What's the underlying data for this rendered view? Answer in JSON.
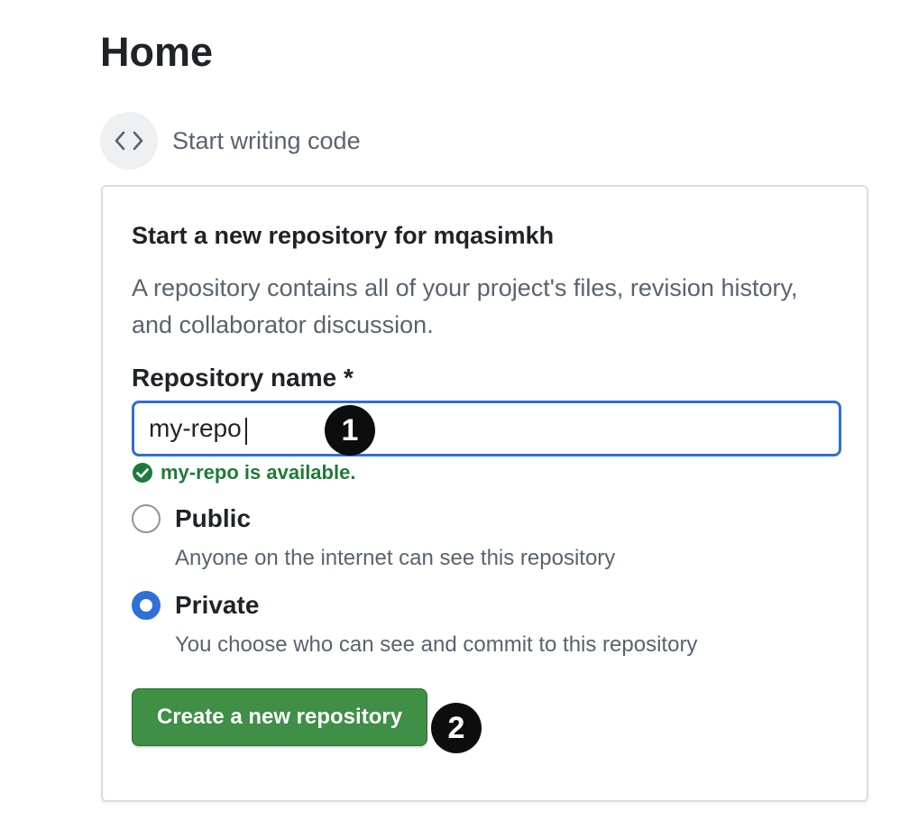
{
  "page": {
    "title": "Home"
  },
  "section": {
    "icon": "code-icon",
    "label": "Start writing code"
  },
  "new_repo_card": {
    "title": "Start a new repository for mqasimkh",
    "description": "A repository contains all of your project's files, revision history, and collaborator discussion.",
    "repo_name_label": "Repository name *",
    "repo_name_value": "my-repo",
    "availability_icon": "check-circle-icon",
    "availability_text": "my-repo is available.",
    "visibility_options": [
      {
        "label": "Public",
        "description": "Anyone on the internet can see this repository",
        "selected": false
      },
      {
        "label": "Private",
        "description": "You choose who can see and commit to this repository",
        "selected": true
      }
    ],
    "create_button_label": "Create a new repository"
  },
  "step_markers": [
    "1",
    "2"
  ],
  "colors": {
    "accent_blue": "#2f6fd8",
    "success_green": "#1f7a3a",
    "button_green": "#3f8f46",
    "muted_text": "#59636e"
  }
}
